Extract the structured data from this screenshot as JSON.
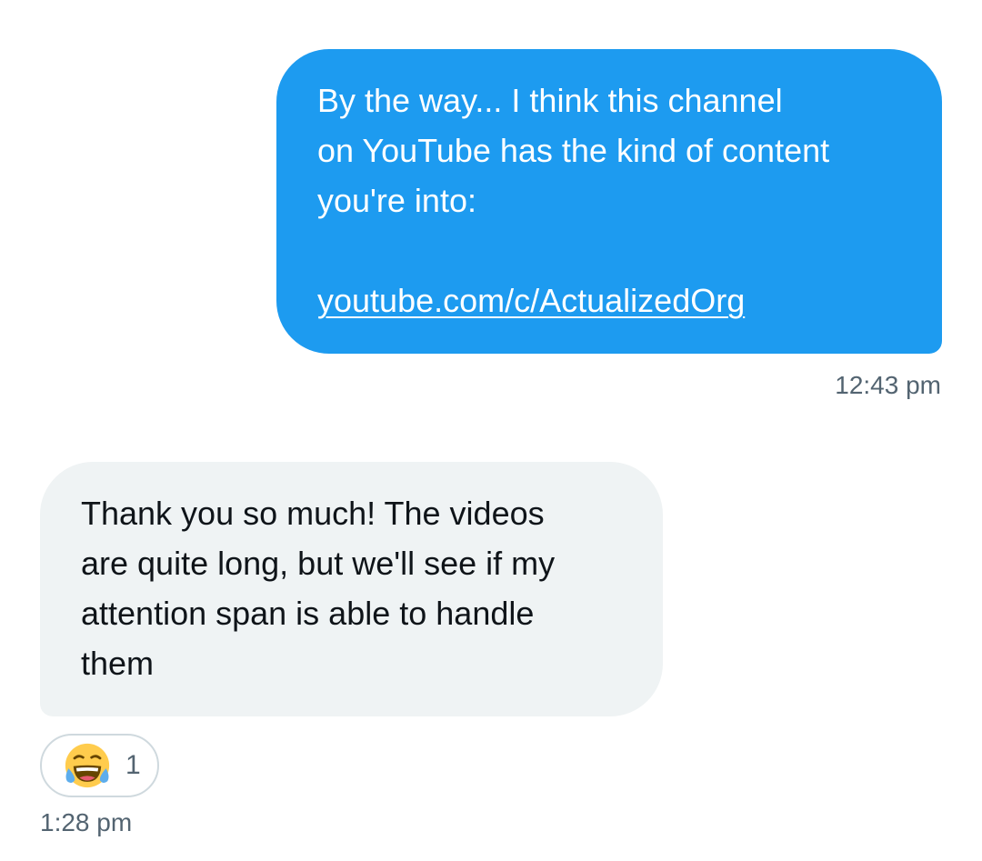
{
  "conversation": {
    "messages": [
      {
        "direction": "sent",
        "text": "By the way... I think this channel\non YouTube has the kind of content\nyou're into:\n\n",
        "link": "youtube.com/c/ActualizedOrg",
        "time": "12:43 pm"
      },
      {
        "direction": "received",
        "text": "Thank you so much! The videos\nare quite long, but we'll see if my\nattention span is able to handle\nthem",
        "reaction": {
          "emoji_icon": "face-with-tears-of-joy-icon",
          "count": "1"
        },
        "time": "1:28 pm"
      }
    ]
  },
  "colors": {
    "sent_bubble": "#1d9bf0",
    "received_bubble": "#eff3f4",
    "timestamp": "#536471",
    "reaction_border": "#cfd9de"
  }
}
